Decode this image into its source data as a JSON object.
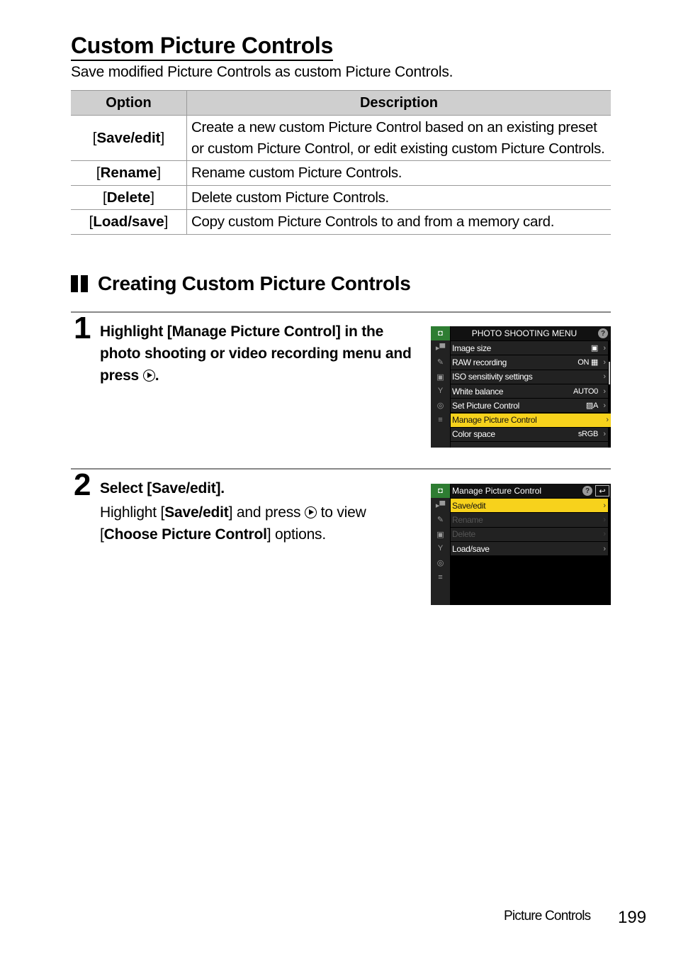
{
  "page": {
    "title": "Custom Picture Controls",
    "subtitle": "Save modified Picture Controls as custom Picture Controls."
  },
  "table": {
    "headers": [
      "Option",
      "Description"
    ],
    "rows": [
      {
        "option_open": "[",
        "option": "Save/edit",
        "option_close": "]",
        "description": "Create a new custom Picture Control based on an existing preset or custom Picture Control, or edit existing custom Picture Controls."
      },
      {
        "option_open": "[",
        "option": "Rename",
        "option_close": "]",
        "description": "Rename custom Picture Controls."
      },
      {
        "option_open": "[",
        "option": "Delete",
        "option_close": "]",
        "description": "Delete custom Picture Controls."
      },
      {
        "option_open": "[",
        "option": "Load/save",
        "option_close": "]",
        "description": "Copy custom Picture Controls to and from a memory card."
      }
    ]
  },
  "section": {
    "title": "Creating Custom Picture Controls"
  },
  "steps": [
    {
      "number": "1",
      "heading_before": "Highlight [Manage Picture Control] in the photo shooting or video recording menu and press",
      "heading_after": ".",
      "screen": {
        "title": "PHOTO SHOOTING MENU",
        "help": "?",
        "side_icons": [
          "camera-icon",
          "video-icon",
          "pencil-icon",
          "playback-icon",
          "wrench-icon",
          "network-icon",
          "my-menu-icon"
        ],
        "items": [
          {
            "label": "Image size",
            "value": "▣",
            "state": "normal"
          },
          {
            "label": "RAW recording",
            "value": "ON ▦",
            "state": "normal"
          },
          {
            "label": "ISO sensitivity settings",
            "value": "",
            "state": "normal"
          },
          {
            "label": "White balance",
            "value": "AUTO0",
            "state": "normal"
          },
          {
            "label": "Set Picture Control",
            "value": "▨A",
            "state": "normal"
          },
          {
            "label": "Manage Picture Control",
            "value": "",
            "state": "highlighted"
          },
          {
            "label": "Color space",
            "value": "sRGB",
            "state": "normal"
          }
        ]
      }
    },
    {
      "number": "2",
      "heading": "Select [Save/edit].",
      "body_1": "Highlight [",
      "body_bold_1": "Save/edit",
      "body_2": "] and press",
      "body_3": "to view [",
      "body_bold_2": "Choose Picture Control",
      "body_4": "] options.",
      "screen": {
        "title": "Manage Picture Control",
        "help": "?",
        "back": "↩",
        "items": [
          {
            "label": "Save/edit",
            "state": "highlighted"
          },
          {
            "label": "Rename",
            "state": "disabled"
          },
          {
            "label": "Delete",
            "state": "disabled"
          },
          {
            "label": "Load/save",
            "state": "normal"
          }
        ]
      }
    }
  ],
  "footer": {
    "section_label": "Picture Controls",
    "page_number": "199"
  }
}
